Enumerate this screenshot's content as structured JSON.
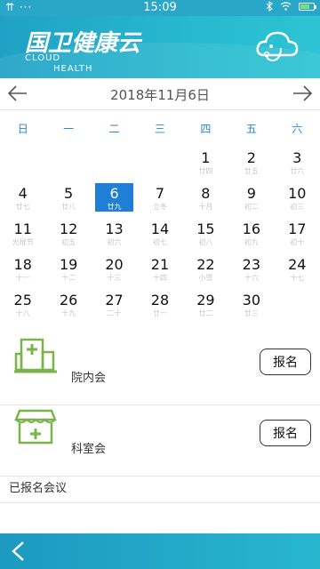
{
  "statusbar": {
    "left": "⇈ ···",
    "time": "15:09",
    "icons": [
      "bluetooth-icon",
      "wifi-icon",
      "battery-icon"
    ]
  },
  "header": {
    "logo_cn": "国卫健康云",
    "logo_en_line1": "CLOUD",
    "logo_en_line2": "HEALTH",
    "icon": "cloud-stethoscope-icon"
  },
  "datebar": {
    "title": "2018年11月6日",
    "prev_icon": "arrow-left-icon",
    "next_icon": "arrow-right-icon"
  },
  "weekdays": [
    "日",
    "一",
    "二",
    "三",
    "四",
    "五",
    "六"
  ],
  "calendar": {
    "selected_day": "6",
    "weeks": [
      [
        {
          "d": "",
          "l": ""
        },
        {
          "d": "",
          "l": ""
        },
        {
          "d": "",
          "l": ""
        },
        {
          "d": "",
          "l": ""
        },
        {
          "d": "1",
          "l": "廿四"
        },
        {
          "d": "2",
          "l": "廿五"
        },
        {
          "d": "3",
          "l": "廿六"
        }
      ],
      [
        {
          "d": "4",
          "l": "廿七"
        },
        {
          "d": "5",
          "l": "廿八"
        },
        {
          "d": "6",
          "l": "廿九"
        },
        {
          "d": "7",
          "l": "立冬"
        },
        {
          "d": "8",
          "l": "十月"
        },
        {
          "d": "9",
          "l": "初二"
        },
        {
          "d": "10",
          "l": "初三"
        }
      ],
      [
        {
          "d": "11",
          "l": "光棍节"
        },
        {
          "d": "12",
          "l": "初五"
        },
        {
          "d": "13",
          "l": "初六"
        },
        {
          "d": "14",
          "l": "初七"
        },
        {
          "d": "15",
          "l": "初八"
        },
        {
          "d": "16",
          "l": "初九"
        },
        {
          "d": "17",
          "l": "初十"
        }
      ],
      [
        {
          "d": "18",
          "l": "十一"
        },
        {
          "d": "19",
          "l": "十二"
        },
        {
          "d": "20",
          "l": "十三"
        },
        {
          "d": "21",
          "l": "十四"
        },
        {
          "d": "22",
          "l": "小雪"
        },
        {
          "d": "23",
          "l": "十六"
        },
        {
          "d": "24",
          "l": "十七"
        }
      ],
      [
        {
          "d": "25",
          "l": "十八"
        },
        {
          "d": "26",
          "l": "十九"
        },
        {
          "d": "27",
          "l": "二十"
        },
        {
          "d": "28",
          "l": "廿一"
        },
        {
          "d": "29",
          "l": "廿二"
        },
        {
          "d": "30",
          "l": "廿三"
        },
        {
          "d": "",
          "l": ""
        }
      ]
    ]
  },
  "meetings": [
    {
      "label": "院内会",
      "button": "报名",
      "icon": "hospital-icon"
    },
    {
      "label": "科室会",
      "button": "报名",
      "icon": "clinic-icon"
    }
  ],
  "registered": {
    "label": "已报名会议"
  },
  "bottombar": {
    "back_icon": "chevron-left-icon"
  },
  "colors": {
    "header": "#27b9cf",
    "selected": "#1f7fd6",
    "weekday": "#2a86c8",
    "meeting_icon": "#7ab34a"
  }
}
